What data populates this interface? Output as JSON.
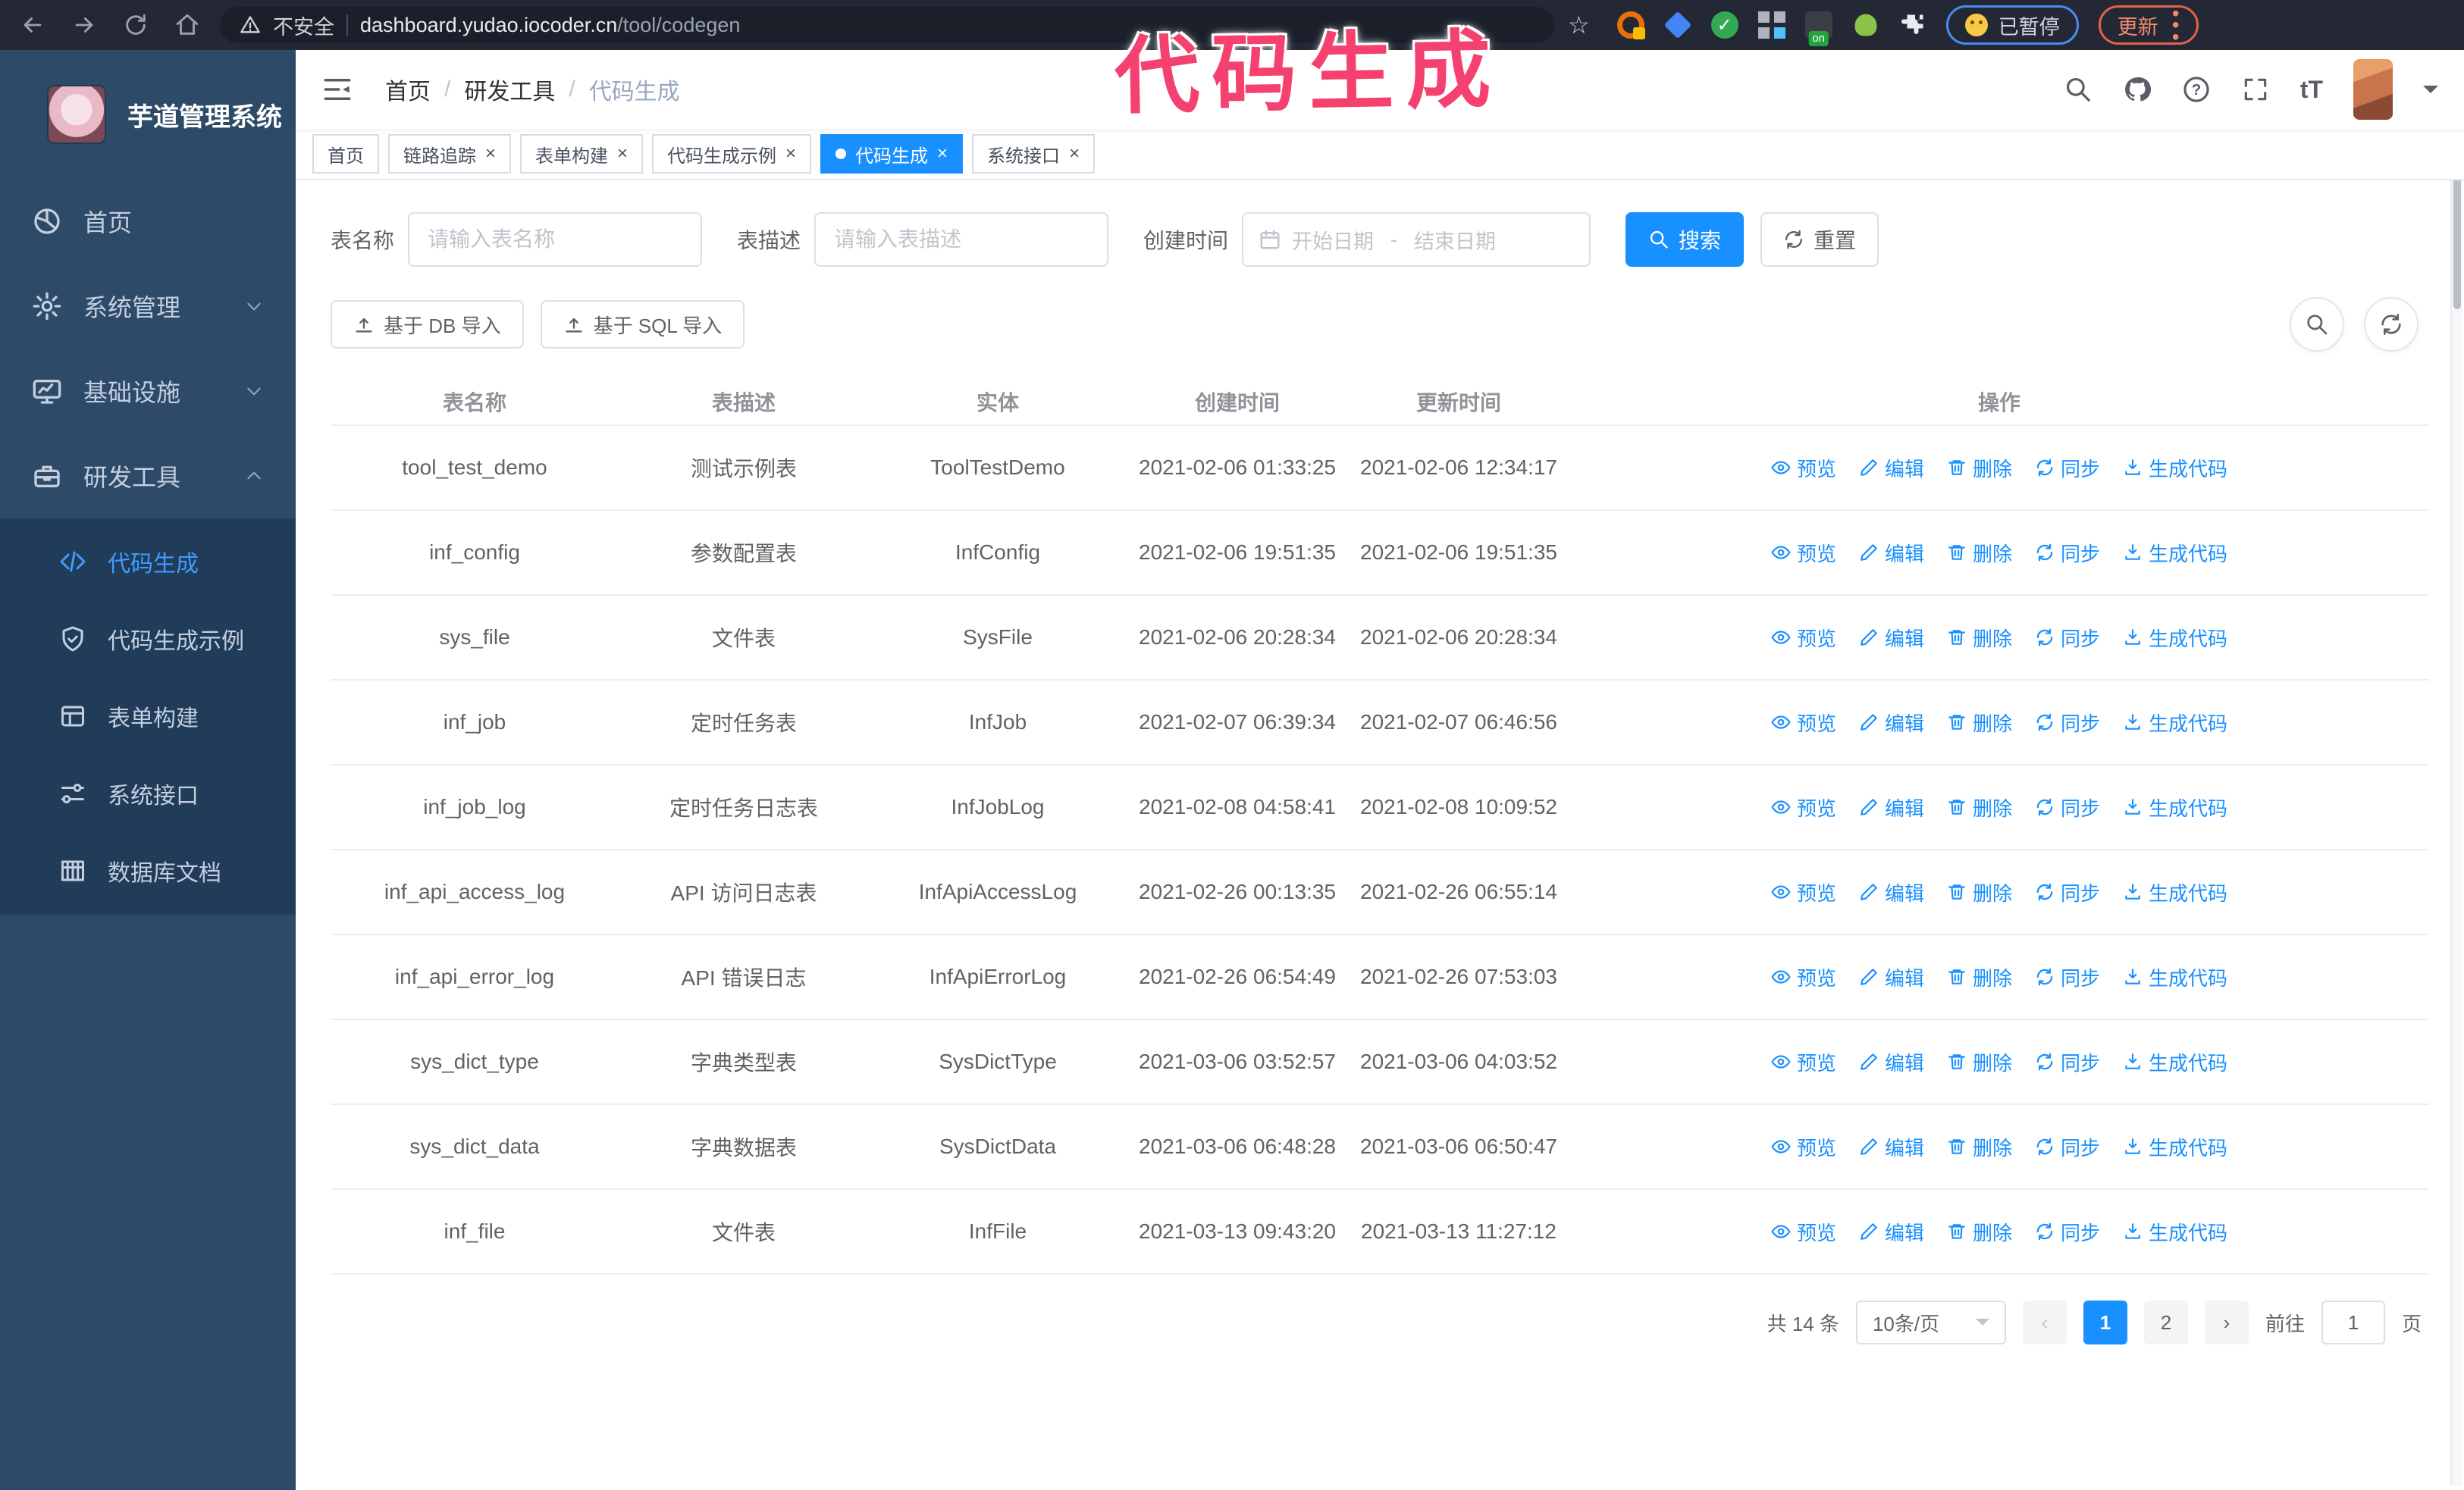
{
  "browser": {
    "security_label": "不安全",
    "url_host": "dashboard.yudao.iocoder.cn",
    "url_path": "/tool/codegen",
    "paused_badge": "已暂停",
    "update_badge": "更新"
  },
  "annotation": {
    "text": "代码生成",
    "color": "#f4416f"
  },
  "sidebar": {
    "app_title": "芋道管理系统",
    "items": [
      {
        "label": "首页"
      },
      {
        "label": "系统管理"
      },
      {
        "label": "基础设施"
      },
      {
        "label": "研发工具",
        "expanded": true
      }
    ],
    "submenu": [
      {
        "label": "代码生成",
        "active": true
      },
      {
        "label": "代码生成示例"
      },
      {
        "label": "表单构建"
      },
      {
        "label": "系统接口"
      },
      {
        "label": "数据库文档"
      }
    ]
  },
  "breadcrumb": {
    "items": [
      "首页",
      "研发工具",
      "代码生成"
    ]
  },
  "tabs": [
    {
      "label": "首页",
      "pinned": true
    },
    {
      "label": "链路追踪"
    },
    {
      "label": "表单构建"
    },
    {
      "label": "代码生成示例"
    },
    {
      "label": "代码生成",
      "active": true
    },
    {
      "label": "系统接口"
    }
  ],
  "filters": {
    "table_name_label": "表名称",
    "table_name_placeholder": "请输入表名称",
    "table_desc_label": "表描述",
    "table_desc_placeholder": "请输入表描述",
    "create_time_label": "创建时间",
    "date_start_placeholder": "开始日期",
    "date_separator": "-",
    "date_end_placeholder": "结束日期",
    "search_label": "搜索",
    "reset_label": "重置"
  },
  "toolbar": {
    "import_db_label": "基于 DB 导入",
    "import_sql_label": "基于 SQL 导入"
  },
  "table": {
    "columns": [
      "表名称",
      "表描述",
      "实体",
      "创建时间",
      "更新时间",
      "操作"
    ],
    "actions": [
      "预览",
      "编辑",
      "删除",
      "同步",
      "生成代码"
    ],
    "rows": [
      {
        "name": "tool_test_demo",
        "desc": "测试示例表",
        "entity": "ToolTestDemo",
        "created": "2021-02-06 01:33:25",
        "updated": "2021-02-06 12:34:17"
      },
      {
        "name": "inf_config",
        "desc": "参数配置表",
        "entity": "InfConfig",
        "created": "2021-02-06 19:51:35",
        "updated": "2021-02-06 19:51:35"
      },
      {
        "name": "sys_file",
        "desc": "文件表",
        "entity": "SysFile",
        "created": "2021-02-06 20:28:34",
        "updated": "2021-02-06 20:28:34"
      },
      {
        "name": "inf_job",
        "desc": "定时任务表",
        "entity": "InfJob",
        "created": "2021-02-07 06:39:34",
        "updated": "2021-02-07 06:46:56"
      },
      {
        "name": "inf_job_log",
        "desc": "定时任务日志表",
        "entity": "InfJobLog",
        "created": "2021-02-08 04:58:41",
        "updated": "2021-02-08 10:09:52"
      },
      {
        "name": "inf_api_access_log",
        "desc": "API 访问日志表",
        "entity": "InfApiAccessLog",
        "created": "2021-02-26 00:13:35",
        "updated": "2021-02-26 06:55:14"
      },
      {
        "name": "inf_api_error_log",
        "desc": "API 错误日志",
        "entity": "InfApiErrorLog",
        "created": "2021-02-26 06:54:49",
        "updated": "2021-02-26 07:53:03"
      },
      {
        "name": "sys_dict_type",
        "desc": "字典类型表",
        "entity": "SysDictType",
        "created": "2021-03-06 03:52:57",
        "updated": "2021-03-06 04:03:52"
      },
      {
        "name": "sys_dict_data",
        "desc": "字典数据表",
        "entity": "SysDictData",
        "created": "2021-03-06 06:48:28",
        "updated": "2021-03-06 06:50:47"
      },
      {
        "name": "inf_file",
        "desc": "文件表",
        "entity": "InfFile",
        "created": "2021-03-13 09:43:20",
        "updated": "2021-03-13 11:27:12"
      }
    ]
  },
  "pagination": {
    "total_label": "共 14 条",
    "page_size": "10条/页",
    "prev": "‹",
    "next": "›",
    "pages": [
      {
        "num": "1",
        "current": true
      },
      {
        "num": "2"
      }
    ],
    "goto_label": "前往",
    "goto_value": "1",
    "goto_suffix": "页"
  },
  "colors": {
    "accent": "#1890ff",
    "sidebar_bg": "#2d4a68",
    "submenu_bg": "#203c59",
    "chrome_bg": "#232834",
    "annotation_pink": "#f4416f"
  }
}
